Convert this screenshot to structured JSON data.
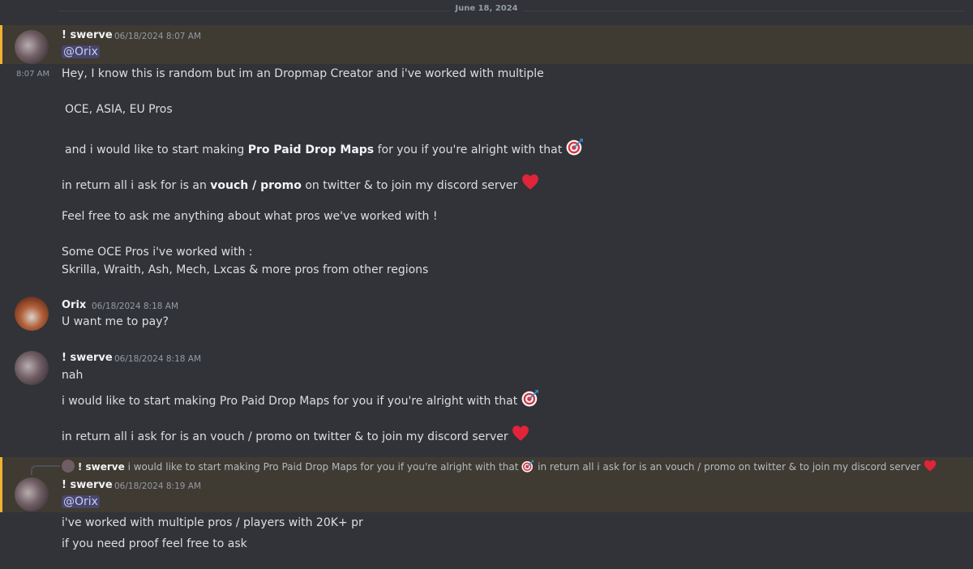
{
  "date_divider": "June 18, 2024",
  "messages": [
    {
      "author": "! swerve",
      "timestamp": "06/18/2024 8:07 AM",
      "mention": "@Orix",
      "lines": [
        "Hey, I know this is random but im an Dropmap Creator and i've worked with multiple",
        "OCE, ASIA, EU Pros",
        "and i would like to start making ",
        "Pro Paid Drop Maps",
        " for you if you're alright with that",
        "in return all i ask for is an ",
        "vouch / promo",
        " on twitter & to join my discord server",
        "Feel free to ask me anything about what pros we've worked with !",
        "Some OCE Pros i've worked with :",
        "Skrilla, Wraith, Ash, Mech, Lxcas & more pros from other regions"
      ],
      "hover_time": "8:07 AM"
    },
    {
      "author": "Orix",
      "timestamp": "06/18/2024 8:18 AM",
      "lines": [
        "U want me to pay?"
      ]
    },
    {
      "author": "! swerve",
      "timestamp": "06/18/2024 8:18 AM",
      "lines": [
        "nah",
        "i would like to start making Pro Paid Drop Maps for you if you're alright with that",
        "in return all i ask for is an vouch / promo on twitter & to join my discord server"
      ]
    },
    {
      "reply": {
        "author": "! swerve",
        "text_a": "i would like to start making Pro Paid Drop Maps for you if you're alright with that",
        "text_b": "in return all i ask for is an vouch / promo on twitter & to join my discord server"
      },
      "author": "! swerve",
      "timestamp": "06/18/2024 8:19 AM",
      "mention": "@Orix",
      "lines": [
        "i've worked with multiple pros / players with 20K+ pr",
        "if you need proof feel free to ask"
      ]
    }
  ],
  "icons": {
    "target": "direct-hit-emoji",
    "heart": "red-heart-emoji"
  },
  "colors": {
    "background": "#313338",
    "mention_highlight": "#3f3a32",
    "mention_bar": "#f0b232",
    "mention_pill": "#c9cdfb",
    "heart": "#e0243a",
    "target": "#d9303e"
  }
}
